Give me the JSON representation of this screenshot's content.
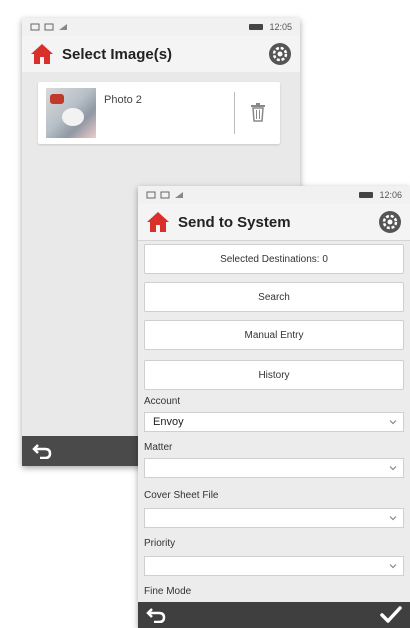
{
  "phone1": {
    "status": {
      "icons_left": [
        "sim-icon",
        "sim-icon",
        "signal-icon"
      ],
      "time": "12:05"
    },
    "header": {
      "title": "Select Image(s)"
    },
    "photos": [
      {
        "name": "Photo 2"
      }
    ]
  },
  "phone2": {
    "status": {
      "icons_left": [
        "sim-icon",
        "sim-icon",
        "signal-icon"
      ],
      "time": "12:06"
    },
    "header": {
      "title": "Send to System"
    },
    "buttons": {
      "selected_destinations": "Selected Destinations: 0",
      "search": "Search",
      "manual_entry": "Manual Entry",
      "history": "History"
    },
    "fields": {
      "account_label": "Account",
      "account_value": "Envoy",
      "matter_label": "Matter",
      "matter_value": "",
      "cover_sheet_label": "Cover Sheet File",
      "cover_sheet_value": "",
      "priority_label": "Priority",
      "priority_value": "",
      "fine_mode_label": "Fine Mode"
    }
  },
  "colors": {
    "home_icon": "#d9302c",
    "bottom_bar": "#4a4a4a",
    "gear": "#555555"
  }
}
